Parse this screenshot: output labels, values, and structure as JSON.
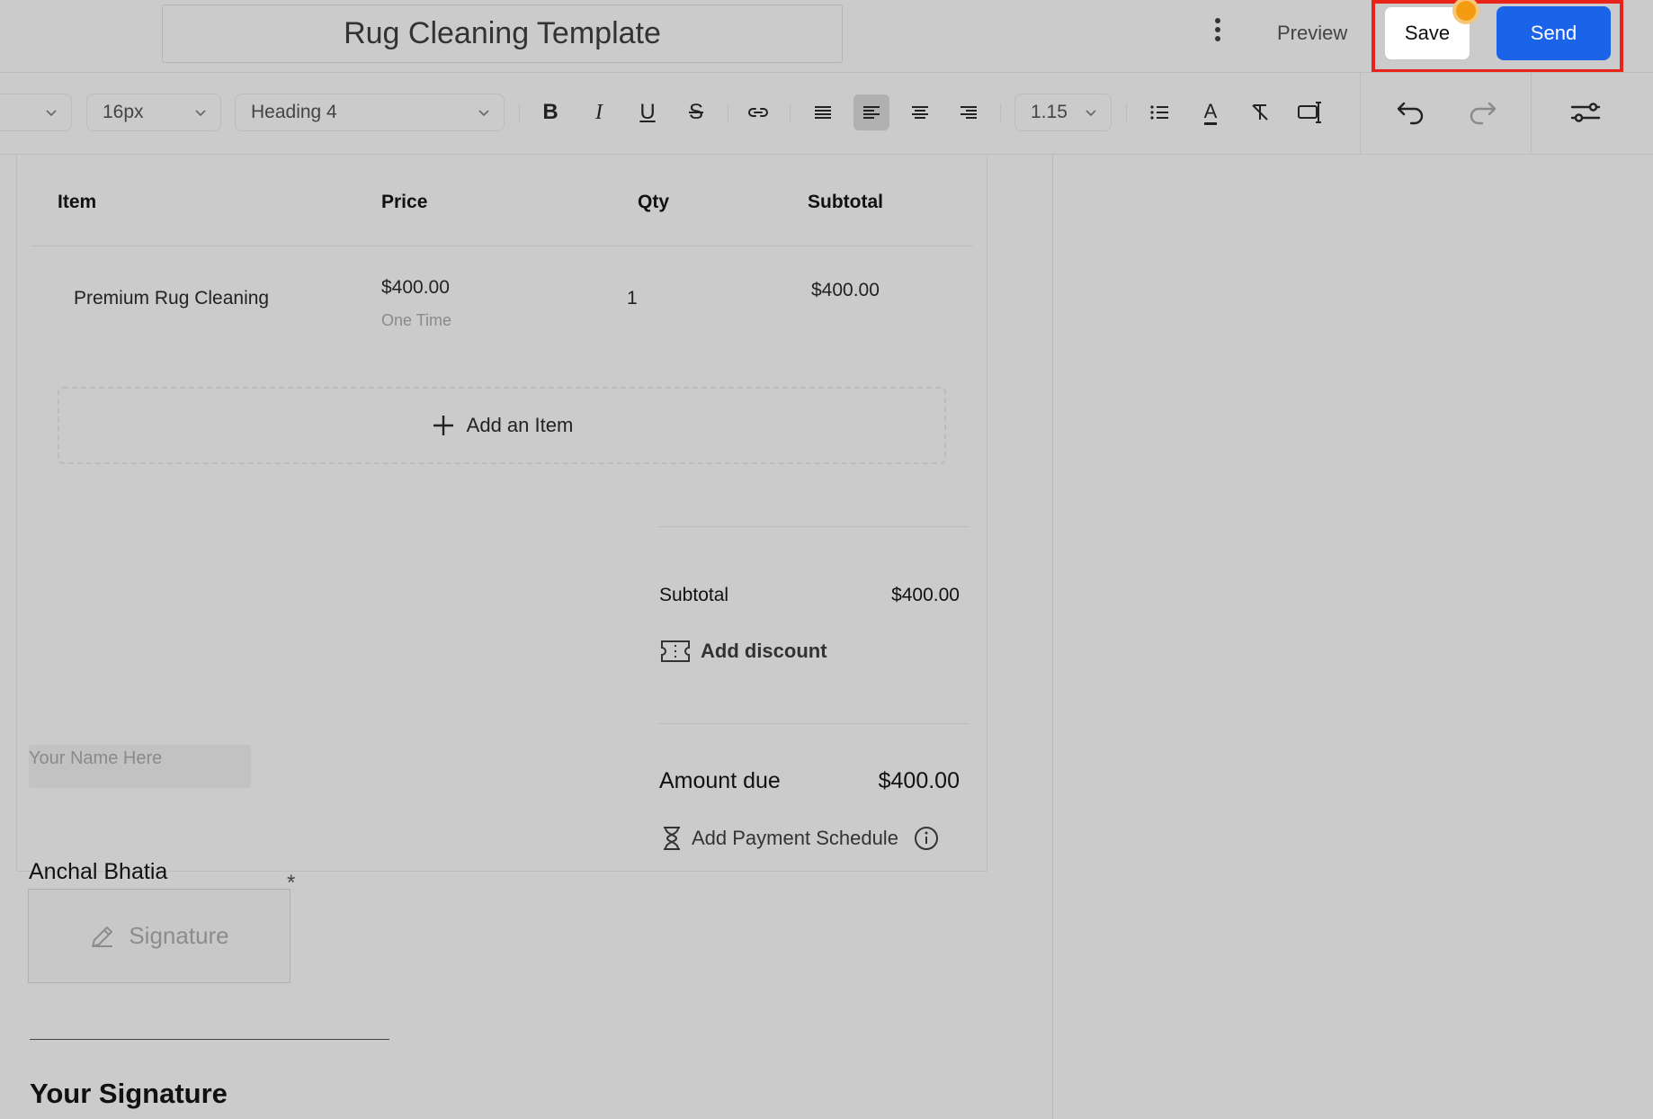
{
  "header": {
    "title": "Rug Cleaning Template",
    "preview_label": "Preview",
    "save_label": "Save",
    "send_label": "Send"
  },
  "toolbar": {
    "font_size": "16px",
    "block_style": "Heading 4",
    "line_height": "1.15",
    "bold_label": "B",
    "italic_label": "I",
    "underline_label": "U",
    "strike_label": "S",
    "text_color_label": "A"
  },
  "table": {
    "columns": [
      "Item",
      "Price",
      "Qty",
      "Subtotal"
    ],
    "rows": [
      {
        "item": "Premium Rug Cleaning",
        "price": "$400.00",
        "frequency": "One Time",
        "qty": "1",
        "subtotal": "$400.00"
      }
    ],
    "add_item_label": "Add an Item"
  },
  "summary": {
    "subtotal_label": "Subtotal",
    "subtotal_value": "$400.00",
    "add_discount_label": "Add discount",
    "amount_due_label": "Amount due",
    "amount_due_value": "$400.00",
    "payment_schedule_label": "Add Payment Schedule"
  },
  "signature": {
    "name_placeholder": "Your Name Here",
    "signer_name": "Anchal Bhatia",
    "signature_label": "Signature",
    "required_mark": "*",
    "your_signature_heading": "Your Signature"
  },
  "colors": {
    "background": "#cbcbcb",
    "accent": "#1b64e9",
    "highlight": "#e8231a",
    "notification_dot": "#f39c12"
  }
}
